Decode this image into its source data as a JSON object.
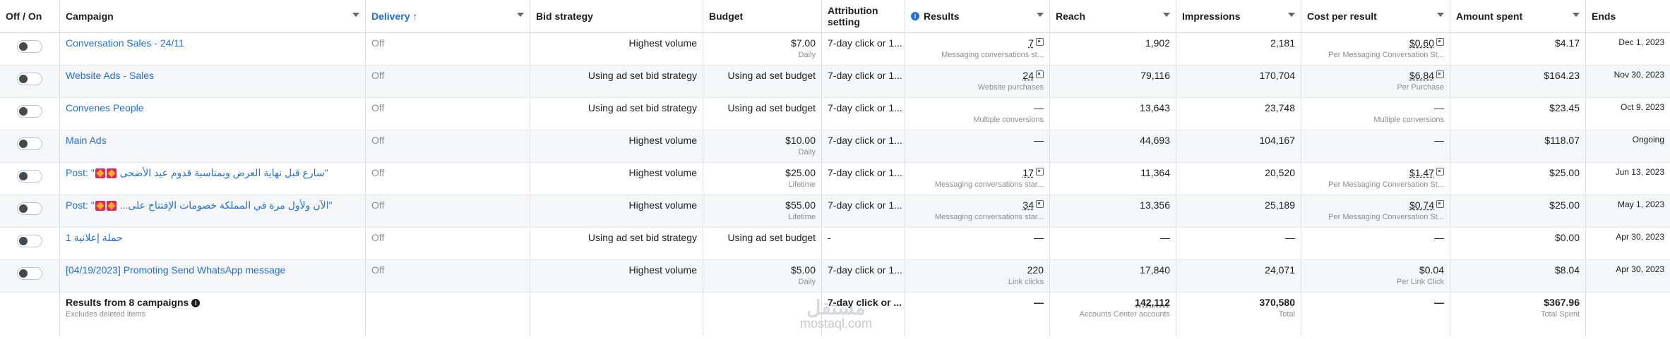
{
  "header": {
    "toggle": "Off / On",
    "campaign": "Campaign",
    "delivery": "Delivery ↑",
    "bid_strategy": "Bid strategy",
    "budget": "Budget",
    "attribution": "Attribution setting",
    "results": "Results",
    "reach": "Reach",
    "impressions": "Impressions",
    "cost_per_result": "Cost per result",
    "amount_spent": "Amount spent",
    "ends": "Ends"
  },
  "rows": [
    {
      "campaign": "Conversation Sales - 24/11",
      "delivery": "Off",
      "bid": "Highest volume",
      "budget": "$7.00",
      "budget_sub": "Daily",
      "attr": "7-day click or 1...",
      "results": "7",
      "results_sub": "Messaging conversations st...",
      "reach": "1,902",
      "impressions": "2,181",
      "cpr": "$0.60",
      "cpr_sub": "Per Messaging Conversation St...",
      "spent": "$4.17",
      "ends": "Dec 1, 2023"
    },
    {
      "campaign": "Website Ads - Sales",
      "delivery": "Off",
      "bid": "Using ad set bid strategy",
      "budget": "Using ad set budget",
      "budget_sub": "",
      "attr": "7-day click or 1...",
      "results": "24",
      "results_sub": "Website purchases",
      "reach": "79,116",
      "impressions": "170,704",
      "cpr": "$6.84",
      "cpr_sub": "Per Purchase",
      "spent": "$164.23",
      "ends": "Nov 30, 2023"
    },
    {
      "campaign": "Convenes People",
      "delivery": "Off",
      "bid": "Using ad set bid strategy",
      "budget": "Using ad set budget",
      "budget_sub": "",
      "attr": "7-day click or 1...",
      "results": "—",
      "results_sub": "Multiple conversions",
      "reach": "13,643",
      "impressions": "23,748",
      "cpr": "—",
      "cpr_sub": "Multiple conversions",
      "spent": "$23.45",
      "ends": "Oct 9, 2023"
    },
    {
      "campaign": "Main Ads",
      "delivery": "Off",
      "bid": "Highest volume",
      "budget": "$10.00",
      "budget_sub": "Daily",
      "attr": "7-day click or 1...",
      "results": "—",
      "results_sub": "",
      "reach": "44,693",
      "impressions": "104,167",
      "cpr": "—",
      "cpr_sub": "",
      "spent": "$118.07",
      "ends": "Ongoing"
    },
    {
      "campaign_prefix": "Post: \"",
      "campaign_arabic": "سارع قبل نهاية العرض وبمناسبة قدوم عيد الأضحى",
      "campaign_suffix": "\"",
      "delivery": "Off",
      "bid": "Highest volume",
      "budget": "$25.00",
      "budget_sub": "Lifetime",
      "attr": "7-day click or 1...",
      "results": "17",
      "results_sub": "Messaging conversations star...",
      "reach": "11,364",
      "impressions": "20,520",
      "cpr": "$1.47",
      "cpr_sub": "Per Messaging Conversation St...",
      "spent": "$25.00",
      "ends": "Jun 13, 2023"
    },
    {
      "campaign_prefix": "Post: \"",
      "campaign_arabic": "الآن ولأول مرة في المملكة خصومات الإفتتاح على...",
      "campaign_suffix": "\"",
      "delivery": "Off",
      "bid": "Highest volume",
      "budget": "$55.00",
      "budget_sub": "Lifetime",
      "attr": "7-day click or 1...",
      "results": "34",
      "results_sub": "Messaging conversations star...",
      "reach": "13,356",
      "impressions": "25,189",
      "cpr": "$0.74",
      "cpr_sub": "Per Messaging Conversation St...",
      "spent": "$25.00",
      "ends": "May 1, 2023"
    },
    {
      "campaign": "حملة إعلانية 1",
      "delivery": "Off",
      "bid": "Using ad set bid strategy",
      "budget": "Using ad set budget",
      "budget_sub": "",
      "attr": "-",
      "results": "—",
      "results_sub": "",
      "reach": "—",
      "impressions": "—",
      "cpr": "—",
      "cpr_sub": "",
      "spent": "$0.00",
      "ends": "Apr 30, 2023"
    },
    {
      "campaign": "[04/19/2023] Promoting Send WhatsApp message",
      "delivery": "Off",
      "bid": "Highest volume",
      "budget": "$5.00",
      "budget_sub": "Daily",
      "attr": "7-day click or 1...",
      "results": "220",
      "results_sub": "Link clicks",
      "reach": "17,840",
      "impressions": "24,071",
      "cpr": "$0.04",
      "cpr_sub": "Per Link Click",
      "spent": "$8.04",
      "ends": "Apr 30, 2023"
    }
  ],
  "totals": {
    "label": "Results from 8 campaigns",
    "sub": "Excludes deleted items",
    "attr": "7-day click or ...",
    "results": "—",
    "reach": "142,112",
    "reach_sub": "Accounts Center accounts",
    "impressions": "370,580",
    "impressions_sub": "Total",
    "cpr": "—",
    "spent": "$367.96",
    "spent_sub": "Total Spent"
  },
  "watermark": {
    "logo": "مستقل",
    "text": "mostaql.com"
  },
  "colors": {
    "link": "#216fdb",
    "muted": "#8a8d91",
    "row_alt": "#f5f6f7",
    "border": "#dadde1"
  }
}
